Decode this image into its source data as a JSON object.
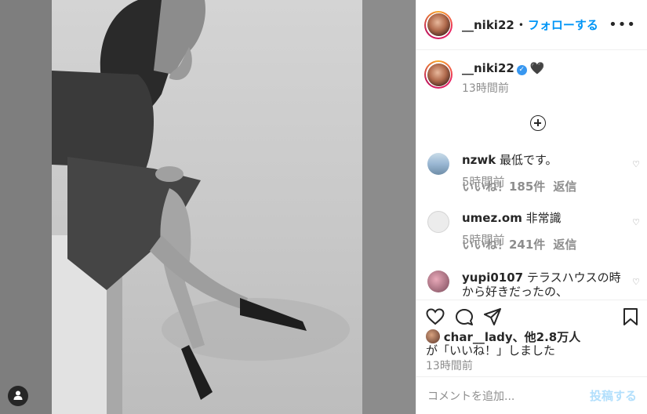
{
  "header": {
    "username": "__niki22",
    "separator": "•",
    "follow_label": "フォローする",
    "more_icon": "more-horizontal-icon"
  },
  "caption": {
    "username": "__niki22",
    "verified_mark": "✓",
    "text": "🖤",
    "time": "13時間前"
  },
  "comments": [
    {
      "username": "nzwk",
      "text": "最低です。",
      "time": "5時間前",
      "likes": "いいね！185件",
      "reply_label": "返信",
      "avatar_color": "#9ab7d3"
    },
    {
      "username": "umez.om",
      "text": "非常識",
      "time": "5時間前",
      "likes": "いいね！241件",
      "reply_label": "返信",
      "avatar_color": "#e0e0e0"
    },
    {
      "username": "yupi0107",
      "text": "テラスハウスの時から好きだったの、",
      "avatar_color": "#7a4a5a"
    }
  ],
  "likes": {
    "prefix_user": "char__lady",
    "suffix": "、他2.8万人",
    "line2": "が「いいね！」しました"
  },
  "post_time": "13時間前",
  "add_comment": {
    "placeholder": "コメントを追加...",
    "post_label": "投稿する"
  },
  "colors": {
    "accent": "#0095f6",
    "muted": "#8e8e8e",
    "post_disabled": "#b2dffc"
  }
}
